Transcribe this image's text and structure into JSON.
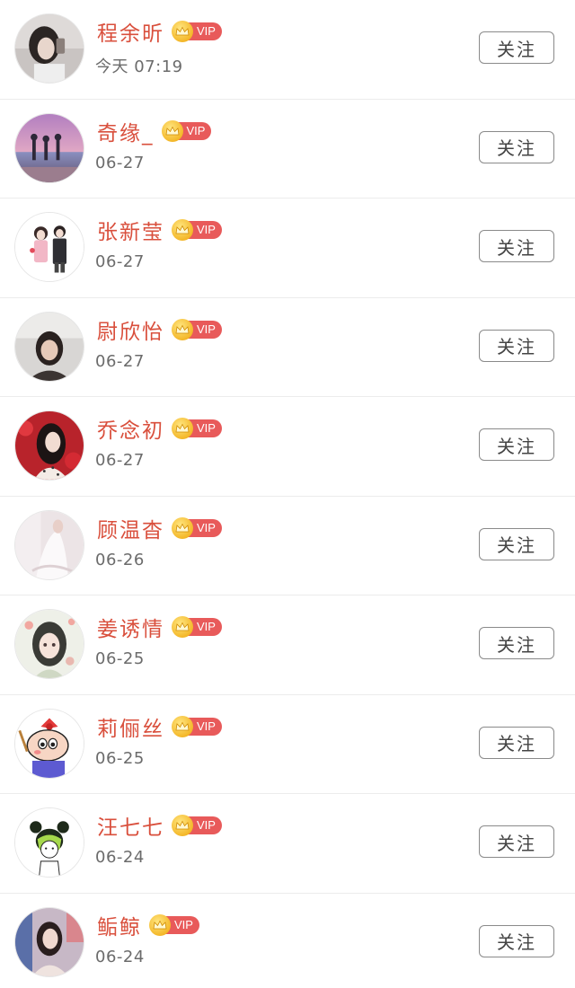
{
  "accent_color": "#d94f3c",
  "vip_color": "#e85a5a",
  "users": [
    {
      "name": "程余昕",
      "time": "今天 07:19",
      "badge": "VIP",
      "follow_label": "关注",
      "avatar": "selfie-dark-hair"
    },
    {
      "name": "奇缘_",
      "time": "06-27",
      "badge": "VIP",
      "follow_label": "关注",
      "avatar": "beach-sunset"
    },
    {
      "name": "张新莹",
      "time": "06-27",
      "badge": "VIP",
      "follow_label": "关注",
      "avatar": "cartoon-couple"
    },
    {
      "name": "尉欣怡",
      "time": "06-27",
      "badge": "VIP",
      "follow_label": "关注",
      "avatar": "woman-portrait"
    },
    {
      "name": "乔念初",
      "time": "06-27",
      "badge": "VIP",
      "follow_label": "关注",
      "avatar": "woman-red-flowers"
    },
    {
      "name": "顾温杳",
      "time": "06-26",
      "badge": "VIP",
      "follow_label": "关注",
      "avatar": "white-dress"
    },
    {
      "name": "姜诱情",
      "time": "06-25",
      "badge": "VIP",
      "follow_label": "关注",
      "avatar": "anime-girl"
    },
    {
      "name": "莉俪丝",
      "time": "06-25",
      "badge": "VIP",
      "follow_label": "关注",
      "avatar": "crayon-shin-chan"
    },
    {
      "name": "汪七七",
      "time": "06-24",
      "badge": "VIP",
      "follow_label": "关注",
      "avatar": "sketch-girl-buns"
    },
    {
      "name": "鲘鲸",
      "time": "06-24",
      "badge": "VIP",
      "follow_label": "关注",
      "avatar": "woman-selfie"
    }
  ]
}
